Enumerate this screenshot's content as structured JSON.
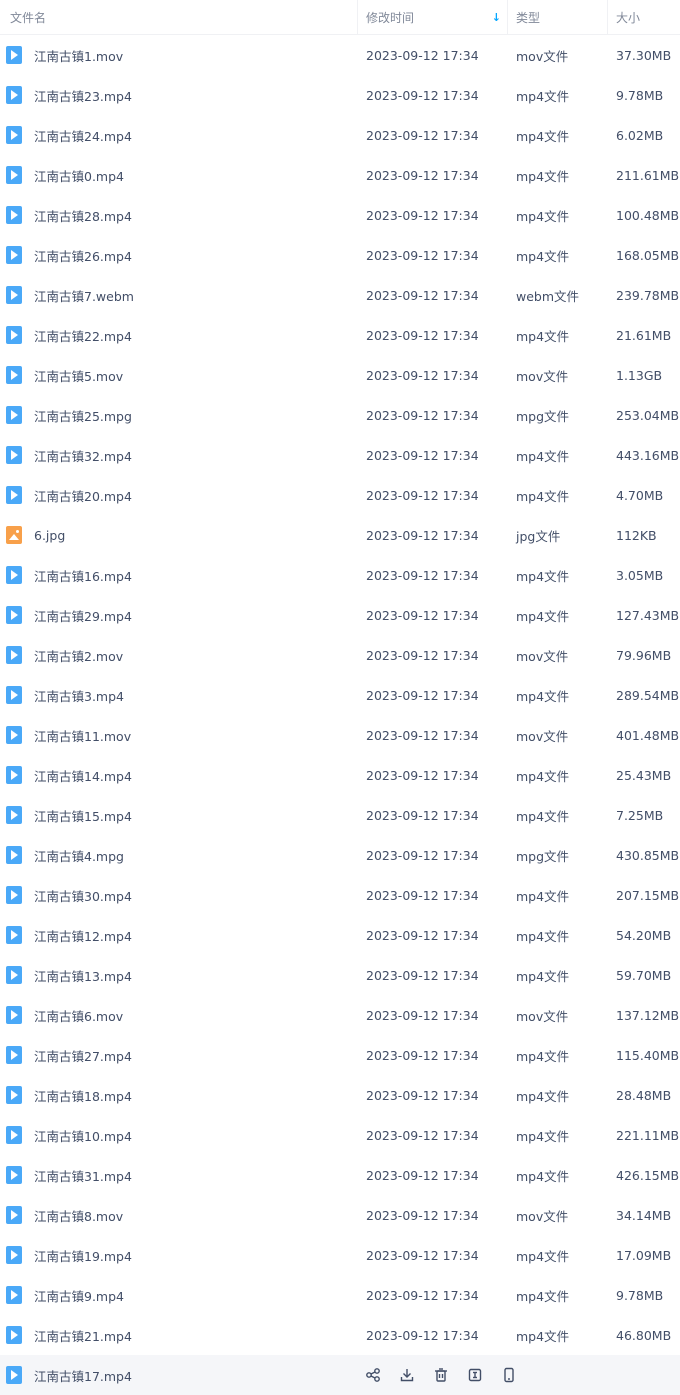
{
  "columns": {
    "name": "文件名",
    "time": "修改时间",
    "type": "类型",
    "size": "大小"
  },
  "files": [
    {
      "name": "江南古镇1.mov",
      "time": "2023-09-12 17:34",
      "type": "mov文件",
      "size": "37.30MB",
      "icon": "video-file-icon"
    },
    {
      "name": "江南古镇23.mp4",
      "time": "2023-09-12 17:34",
      "type": "mp4文件",
      "size": "9.78MB",
      "icon": "video-file-icon"
    },
    {
      "name": "江南古镇24.mp4",
      "time": "2023-09-12 17:34",
      "type": "mp4文件",
      "size": "6.02MB",
      "icon": "video-file-icon"
    },
    {
      "name": "江南古镇0.mp4",
      "time": "2023-09-12 17:34",
      "type": "mp4文件",
      "size": "211.61MB",
      "icon": "video-file-icon"
    },
    {
      "name": "江南古镇28.mp4",
      "time": "2023-09-12 17:34",
      "type": "mp4文件",
      "size": "100.48MB",
      "icon": "video-file-icon"
    },
    {
      "name": "江南古镇26.mp4",
      "time": "2023-09-12 17:34",
      "type": "mp4文件",
      "size": "168.05MB",
      "icon": "video-file-icon"
    },
    {
      "name": "江南古镇7.webm",
      "time": "2023-09-12 17:34",
      "type": "webm文件",
      "size": "239.78MB",
      "icon": "video-file-icon"
    },
    {
      "name": "江南古镇22.mp4",
      "time": "2023-09-12 17:34",
      "type": "mp4文件",
      "size": "21.61MB",
      "icon": "video-file-icon"
    },
    {
      "name": "江南古镇5.mov",
      "time": "2023-09-12 17:34",
      "type": "mov文件",
      "size": "1.13GB",
      "icon": "video-file-icon"
    },
    {
      "name": "江南古镇25.mpg",
      "time": "2023-09-12 17:34",
      "type": "mpg文件",
      "size": "253.04MB",
      "icon": "video-file-icon"
    },
    {
      "name": "江南古镇32.mp4",
      "time": "2023-09-12 17:34",
      "type": "mp4文件",
      "size": "443.16MB",
      "icon": "video-file-icon"
    },
    {
      "name": "江南古镇20.mp4",
      "time": "2023-09-12 17:34",
      "type": "mp4文件",
      "size": "4.70MB",
      "icon": "video-file-icon"
    },
    {
      "name": "6.jpg",
      "time": "2023-09-12 17:34",
      "type": "jpg文件",
      "size": "112KB",
      "icon": "image-file-icon"
    },
    {
      "name": "江南古镇16.mp4",
      "time": "2023-09-12 17:34",
      "type": "mp4文件",
      "size": "3.05MB",
      "icon": "video-file-icon"
    },
    {
      "name": "江南古镇29.mp4",
      "time": "2023-09-12 17:34",
      "type": "mp4文件",
      "size": "127.43MB",
      "icon": "video-file-icon"
    },
    {
      "name": "江南古镇2.mov",
      "time": "2023-09-12 17:34",
      "type": "mov文件",
      "size": "79.96MB",
      "icon": "video-file-icon"
    },
    {
      "name": "江南古镇3.mp4",
      "time": "2023-09-12 17:34",
      "type": "mp4文件",
      "size": "289.54MB",
      "icon": "video-file-icon"
    },
    {
      "name": "江南古镇11.mov",
      "time": "2023-09-12 17:34",
      "type": "mov文件",
      "size": "401.48MB",
      "icon": "video-file-icon"
    },
    {
      "name": "江南古镇14.mp4",
      "time": "2023-09-12 17:34",
      "type": "mp4文件",
      "size": "25.43MB",
      "icon": "video-file-icon"
    },
    {
      "name": "江南古镇15.mp4",
      "time": "2023-09-12 17:34",
      "type": "mp4文件",
      "size": "7.25MB",
      "icon": "video-file-icon"
    },
    {
      "name": "江南古镇4.mpg",
      "time": "2023-09-12 17:34",
      "type": "mpg文件",
      "size": "430.85MB",
      "icon": "video-file-icon"
    },
    {
      "name": "江南古镇30.mp4",
      "time": "2023-09-12 17:34",
      "type": "mp4文件",
      "size": "207.15MB",
      "icon": "video-file-icon"
    },
    {
      "name": "江南古镇12.mp4",
      "time": "2023-09-12 17:34",
      "type": "mp4文件",
      "size": "54.20MB",
      "icon": "video-file-icon"
    },
    {
      "name": "江南古镇13.mp4",
      "time": "2023-09-12 17:34",
      "type": "mp4文件",
      "size": "59.70MB",
      "icon": "video-file-icon"
    },
    {
      "name": "江南古镇6.mov",
      "time": "2023-09-12 17:34",
      "type": "mov文件",
      "size": "137.12MB",
      "icon": "video-file-icon"
    },
    {
      "name": "江南古镇27.mp4",
      "time": "2023-09-12 17:34",
      "type": "mp4文件",
      "size": "115.40MB",
      "icon": "video-file-icon"
    },
    {
      "name": "江南古镇18.mp4",
      "time": "2023-09-12 17:34",
      "type": "mp4文件",
      "size": "28.48MB",
      "icon": "video-file-icon"
    },
    {
      "name": "江南古镇10.mp4",
      "time": "2023-09-12 17:34",
      "type": "mp4文件",
      "size": "221.11MB",
      "icon": "video-file-icon"
    },
    {
      "name": "江南古镇31.mp4",
      "time": "2023-09-12 17:34",
      "type": "mp4文件",
      "size": "426.15MB",
      "icon": "video-file-icon"
    },
    {
      "name": "江南古镇8.mov",
      "time": "2023-09-12 17:34",
      "type": "mov文件",
      "size": "34.14MB",
      "icon": "video-file-icon"
    },
    {
      "name": "江南古镇19.mp4",
      "time": "2023-09-12 17:34",
      "type": "mp4文件",
      "size": "17.09MB",
      "icon": "video-file-icon"
    },
    {
      "name": "江南古镇9.mp4",
      "time": "2023-09-12 17:34",
      "type": "mp4文件",
      "size": "9.78MB",
      "icon": "video-file-icon"
    },
    {
      "name": "江南古镇21.mp4",
      "time": "2023-09-12 17:34",
      "type": "mp4文件",
      "size": "46.80MB",
      "icon": "video-file-icon"
    }
  ],
  "hover_row": {
    "name": "江南古镇17.mp4",
    "icon": "video-file-icon",
    "actions": [
      "share-icon",
      "download-icon",
      "delete-icon",
      "rename-icon",
      "phone-icon"
    ]
  },
  "colors": {
    "accent": "#06a7ff",
    "video_icon": "#4aa9f8",
    "image_icon": "#f8a04a",
    "hover_bg": "#f5f6f9"
  }
}
